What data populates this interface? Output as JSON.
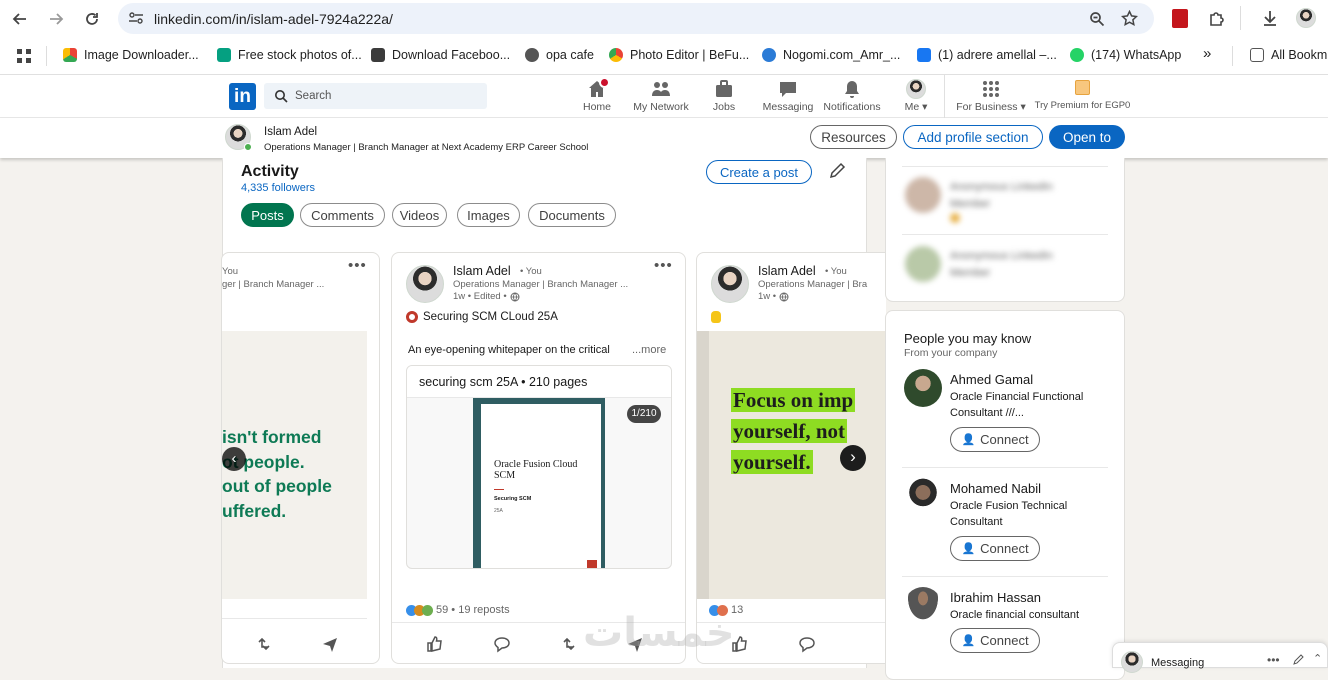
{
  "browser": {
    "url": "linkedin.com/in/islam-adel-7924a222a/",
    "bookmarks": [
      "Image Downloader...",
      "Free stock photos of...",
      "Download Faceboo...",
      "opa cafe",
      "Photo Editor | BeFu...",
      "Nogomi.com_Amr_...",
      "(1) adrere amellal –...",
      "(174) WhatsApp",
      "»",
      "All Bookm"
    ]
  },
  "header": {
    "logo": "in",
    "search_placeholder": "Search",
    "nav": [
      "Home",
      "My Network",
      "Jobs",
      "Messaging",
      "Notifications",
      "Me",
      "For Business",
      "Try Premium for EGP0"
    ]
  },
  "profile_bar": {
    "name": "Islam Adel",
    "headline": "Operations Manager | Branch Manager at Next Academy ERP Career School",
    "resources": "Resources",
    "add_section": "Add profile section",
    "open_to": "Open to"
  },
  "activity": {
    "title": "Activity",
    "followers": "4,335 followers",
    "create_post": "Create a post",
    "filters": [
      "Posts",
      "Comments",
      "Videos",
      "Images",
      "Documents"
    ]
  },
  "posts": {
    "left": {
      "author_tail": "You",
      "sub_tail": "ger | Branch Manager ...",
      "image_lines": [
        "isn't formed",
        "ot people.",
        "out of people",
        "uffered."
      ]
    },
    "center": {
      "author": "Islam Adel",
      "you": "• You",
      "sub": "Operations Manager | Branch Manager ...",
      "time": "1w • Edited •",
      "headline": "Securing SCM CLoud 25A",
      "text": "An eye-opening whitepaper on the critical",
      "more": "...more",
      "doc_title": "securing scm 25A • 210 pages",
      "doc_counter": "1/210",
      "cover_title": "Oracle Fusion Cloud SCM",
      "cover_sub": "Securing SCM",
      "cover_ver": "25A",
      "reactions": "59 • 19 reposts"
    },
    "right": {
      "author": "Islam Adel",
      "you": "• You",
      "sub": "Operations Manager | Bra",
      "time": "1w •",
      "image_lines": [
        "Focus on imp",
        "yourself, not",
        "yourself."
      ],
      "reactions": "13"
    }
  },
  "viewers": [
    "Anonymous LinkedIn Member",
    "Anonymous LinkedIn Member"
  ],
  "pymk": {
    "title": "People you may know",
    "subtitle": "From your company",
    "people": [
      {
        "name": "Ahmed Gamal",
        "headline": "Oracle Financial Functional Consultant ///..."
      },
      {
        "name": "Mohamed Nabil",
        "headline": "Oracle Fusion Technical Consultant"
      },
      {
        "name": "Ibrahim Hassan",
        "headline": "Oracle financial consultant"
      }
    ],
    "connect": "Connect"
  },
  "messaging": {
    "label": "Messaging"
  },
  "watermark": "خمسات",
  "colors": {
    "linkedin_blue": "#0a66c2",
    "posts_green": "#01754f",
    "quote_green": "#0e7a55",
    "highlight": "#8edc22"
  }
}
